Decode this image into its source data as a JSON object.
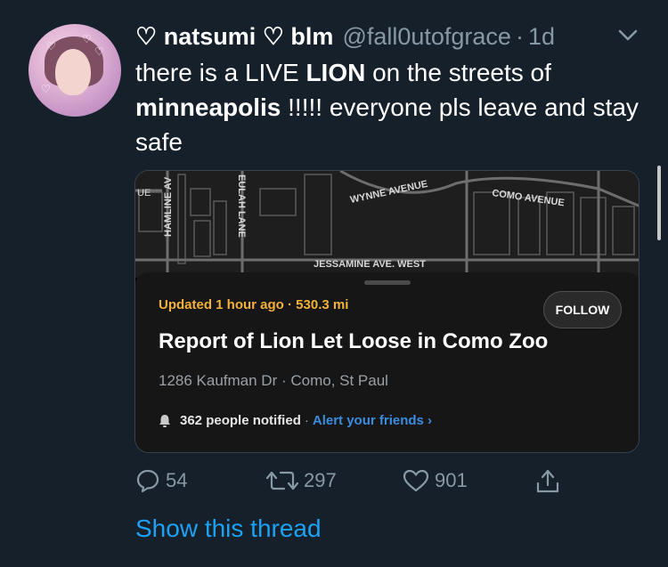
{
  "tweet": {
    "display_name": "♡ natsumi ♡ blm",
    "handle": "@fall0utofgrace",
    "separator": "·",
    "time": "1d",
    "text_parts": [
      {
        "text": "there is a LIVE ",
        "bold": false
      },
      {
        "text": "LION",
        "bold": true
      },
      {
        "text": " on the streets of ",
        "bold": false
      },
      {
        "text": "minneapolis",
        "bold": true
      },
      {
        "text": " !!!!! everyone pls leave and stay safe",
        "bold": false
      }
    ]
  },
  "card": {
    "map_labels": {
      "hamline": "HAMLINE AV",
      "eulah": "EULAH LANE",
      "wynne": "WYNNE AVENUE",
      "como": "COMO AVENUE",
      "jessamine": "JESSAMINE AVE. WEST",
      "ue": "UE"
    },
    "updated": "Updated 1 hour ago · 530.3 mi",
    "follow_label": "FOLLOW",
    "title": "Report of Lion Let Loose in Como Zoo",
    "address": "1286 Kaufman Dr · Como, St Paul",
    "notified_count": "362 people notified",
    "notified_sep": "·",
    "alert_label": "Alert your friends ›"
  },
  "actions": {
    "replies": "54",
    "retweets": "297",
    "likes": "901"
  },
  "show_thread": "Show this thread",
  "colors": {
    "background": "#15202b",
    "link": "#1da1f2",
    "muted": "#8899a6",
    "updated": "#f1b13a",
    "alert": "#3a8de0"
  }
}
